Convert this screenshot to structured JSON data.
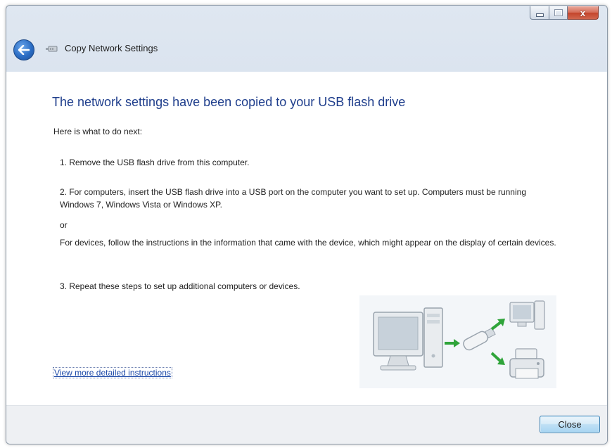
{
  "window": {
    "title": "Copy Network Settings",
    "close_glyph": "x"
  },
  "content": {
    "heading": "The network settings have been copied to your USB flash drive",
    "intro": "Here is what to do next:",
    "steps": {
      "step1": "1. Remove the USB flash drive from this computer.",
      "step2": "2. For computers, insert the USB flash drive into a USB port on the computer you want to set up. Computers must be running Windows 7, Windows Vista or Windows XP.",
      "or": "or",
      "devices": "For devices, follow the instructions in the information that came with the device, which might appear on the display of certain devices.",
      "step3": "3. Repeat these steps to set up additional computers or devices."
    },
    "link_text": "View more detailed instructions"
  },
  "footer": {
    "close_label": "Close"
  },
  "icons": {
    "back": "back-arrow-icon",
    "wizard": "network-wizard-icon",
    "illustration": "computer-usb-transfer-illustration"
  },
  "colors": {
    "heading": "#1f3e8c",
    "link": "#1c49a8",
    "close_caption": "#c4452c",
    "back_button": "#2b6dc4"
  }
}
